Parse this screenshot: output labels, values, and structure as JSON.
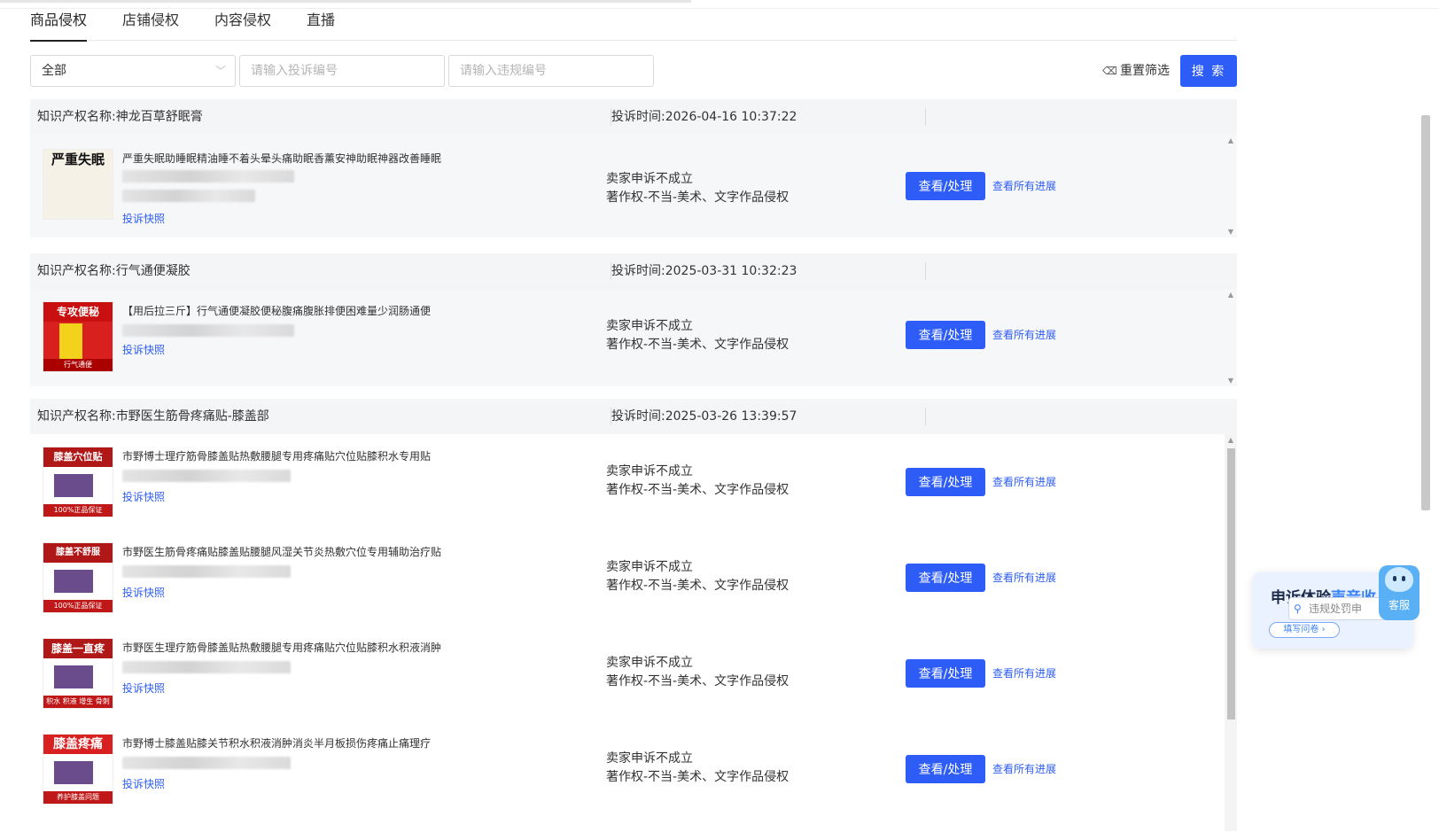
{
  "tabs": [
    "商品侵权",
    "店铺侵权",
    "内容侵权",
    "直播"
  ],
  "filters": {
    "select_value": "全部",
    "complaint_no_placeholder": "请输入投诉编号",
    "violation_no_placeholder": "请输入违规编号",
    "reset_label": "重置筛选",
    "search_label": "搜 索"
  },
  "groups": [
    {
      "ip_name": "知识产权名称:神龙百草舒眠膏",
      "complaint_time": "投诉时间:2026-04-16 10:37:22",
      "items": [
        {
          "title": "严重失眠助睡眠精油睡不着头晕头痛助眠香薰安神助眠神器改善睡眠",
          "thumb_text": "严重失眠",
          "thumb_footer": "",
          "snapshot": "投诉快照",
          "status": "卖家申诉不成立",
          "reason": "著作权-不当-美术、文字作品侵权",
          "action": "查看/处理",
          "progress": "查看所有进展"
        }
      ]
    },
    {
      "ip_name": "知识产权名称:行气通便凝胶",
      "complaint_time": "投诉时间:2025-03-31 10:32:23",
      "items": [
        {
          "title": "【用后拉三斤】行气通便凝胶便秘腹痛腹胀排便困难量少润肠通便",
          "thumb_text": "专攻便秘",
          "thumb_footer": "行气通便",
          "snapshot": "投诉快照",
          "status": "卖家申诉不成立",
          "reason": "著作权-不当-美术、文字作品侵权",
          "action": "查看/处理",
          "progress": "查看所有进展"
        }
      ]
    },
    {
      "ip_name": "知识产权名称:市野医生筋骨疼痛贴-膝盖部",
      "complaint_time": "投诉时间:2025-03-26 13:39:57",
      "items": [
        {
          "title": "市野博士理疗筋骨膝盖贴热敷腰腿专用疼痛贴穴位贴膝积水专用贴",
          "thumb_text": "膝盖穴位贴",
          "thumb_footer": "100%正品保证",
          "snapshot": "投诉快照",
          "status": "卖家申诉不成立",
          "reason": "著作权-不当-美术、文字作品侵权",
          "action": "查看/处理",
          "progress": "查看所有进展"
        },
        {
          "title": "市野医生筋骨疼痛贴膝盖贴腰腿风湿关节炎热敷穴位专用辅助治疗贴",
          "thumb_text": "膝盖不舒服",
          "thumb_footer": "100%正品保证",
          "snapshot": "投诉快照",
          "status": "卖家申诉不成立",
          "reason": "著作权-不当-美术、文字作品侵权",
          "action": "查看/处理",
          "progress": "查看所有进展"
        },
        {
          "title": "市野医生理疗筋骨膝盖贴热敷腰腿专用疼痛贴穴位贴膝积水积液消肿",
          "thumb_text": "膝盖一直疼",
          "thumb_footer": "积水 积液 增生 骨刺",
          "snapshot": "投诉快照",
          "status": "卖家申诉不成立",
          "reason": "著作权-不当-美术、文字作品侵权",
          "action": "查看/处理",
          "progress": "查看所有进展"
        },
        {
          "title": "市野博士膝盖贴膝关节积水积液消肿消炎半月板损伤疼痛止痛理疗",
          "thumb_text": "膝盖疼痛",
          "thumb_footer": "养护膝盖问题",
          "snapshot": "投诉快照",
          "status": "卖家申诉不成立",
          "reason": "著作权-不当-美术、文字作品侵权",
          "action": "查看/处理",
          "progress": "查看所有进展"
        }
      ]
    }
  ],
  "float_widget": {
    "title_a": "申诉体验",
    "title_b": "声音收",
    "search_text": "违规处罚申",
    "button": "填写问卷 ›",
    "kefu_label": "客服"
  },
  "colors": {
    "primary": "#2d5cf6",
    "header_bg": "#f4f5f7"
  },
  "icons": [
    "chevron-down-icon",
    "eraser-icon",
    "search-icon",
    "customer-service-icon"
  ]
}
